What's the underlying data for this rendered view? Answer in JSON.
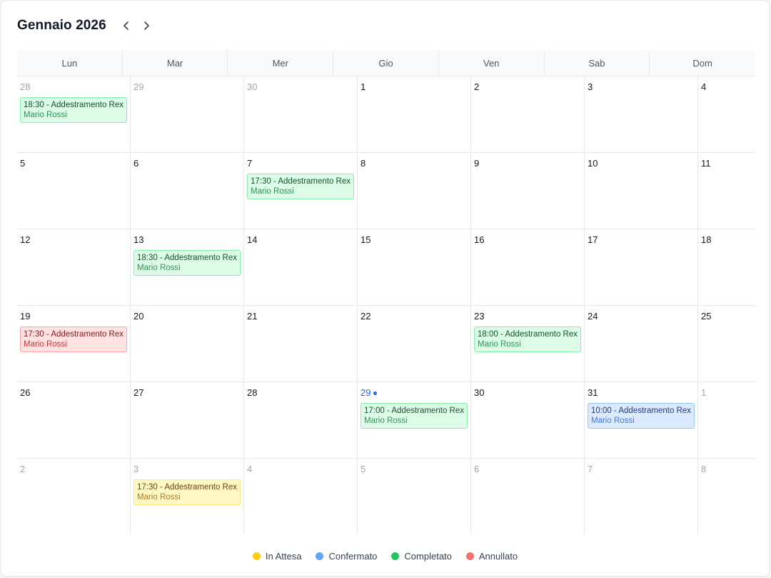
{
  "header": {
    "title": "Gennaio 2026"
  },
  "weekdays": [
    "Lun",
    "Mar",
    "Mer",
    "Gio",
    "Ven",
    "Sab",
    "Dom"
  ],
  "status_colors": {
    "pending": {
      "bg": "#fef9c3",
      "border": "#fde68a",
      "title": "#713f12",
      "sub": "#a16207"
    },
    "confirmed": {
      "bg": "#dbeafe",
      "border": "#93c5fd",
      "title": "#1e3a8a",
      "sub": "#2563eb"
    },
    "completed": {
      "bg": "#dcfce7",
      "border": "#86efac",
      "title": "#14532d",
      "sub": "#15803d"
    },
    "cancelled": {
      "bg": "#fee2e2",
      "border": "#fca5a5",
      "title": "#7f1d1d",
      "sub": "#b91c1c"
    }
  },
  "days": [
    {
      "day": "28",
      "other": true,
      "events": [
        {
          "title": "18:30 - Addestramento Rex",
          "sub": "Mario Rossi",
          "status": "completed"
        }
      ]
    },
    {
      "day": "29",
      "other": true
    },
    {
      "day": "30",
      "other": true
    },
    {
      "day": "1"
    },
    {
      "day": "2"
    },
    {
      "day": "3"
    },
    {
      "day": "4"
    },
    {
      "day": "5"
    },
    {
      "day": "6"
    },
    {
      "day": "7",
      "events": [
        {
          "title": "17:30 - Addestramento Rex",
          "sub": "Mario Rossi",
          "status": "completed"
        }
      ]
    },
    {
      "day": "8"
    },
    {
      "day": "9"
    },
    {
      "day": "10"
    },
    {
      "day": "11"
    },
    {
      "day": "12"
    },
    {
      "day": "13",
      "events": [
        {
          "title": "18:30 - Addestramento Rex",
          "sub": "Mario Rossi",
          "status": "completed"
        }
      ]
    },
    {
      "day": "14"
    },
    {
      "day": "15"
    },
    {
      "day": "16"
    },
    {
      "day": "17"
    },
    {
      "day": "18"
    },
    {
      "day": "19",
      "events": [
        {
          "title": "17:30 - Addestramento Rex",
          "sub": "Mario Rossi",
          "status": "cancelled"
        }
      ]
    },
    {
      "day": "20"
    },
    {
      "day": "21"
    },
    {
      "day": "22"
    },
    {
      "day": "23",
      "events": [
        {
          "title": "18:00 - Addestramento Rex",
          "sub": "Mario Rossi",
          "status": "completed"
        }
      ]
    },
    {
      "day": "24"
    },
    {
      "day": "25"
    },
    {
      "day": "26"
    },
    {
      "day": "27"
    },
    {
      "day": "28"
    },
    {
      "day": "29",
      "today": true,
      "events": [
        {
          "title": "17:00 - Addestramento Rex",
          "sub": "Mario Rossi",
          "status": "completed"
        }
      ]
    },
    {
      "day": "30"
    },
    {
      "day": "31",
      "events": [
        {
          "title": "10:00 - Addestramento Rex",
          "sub": "Mario Rossi",
          "status": "confirmed"
        }
      ]
    },
    {
      "day": "1",
      "other": true
    },
    {
      "day": "2",
      "other": true
    },
    {
      "day": "3",
      "other": true,
      "events": [
        {
          "title": "17:30 - Addestramento Rex",
          "sub": "Mario Rossi",
          "status": "pending"
        }
      ]
    },
    {
      "day": "4",
      "other": true
    },
    {
      "day": "5",
      "other": true
    },
    {
      "day": "6",
      "other": true
    },
    {
      "day": "7",
      "other": true
    },
    {
      "day": "8",
      "other": true
    }
  ],
  "legend": [
    {
      "label": "In Attesa",
      "color": "#facc15"
    },
    {
      "label": "Confermato",
      "color": "#60a5fa"
    },
    {
      "label": "Completato",
      "color": "#22c55e"
    },
    {
      "label": "Annullato",
      "color": "#f87171"
    }
  ]
}
